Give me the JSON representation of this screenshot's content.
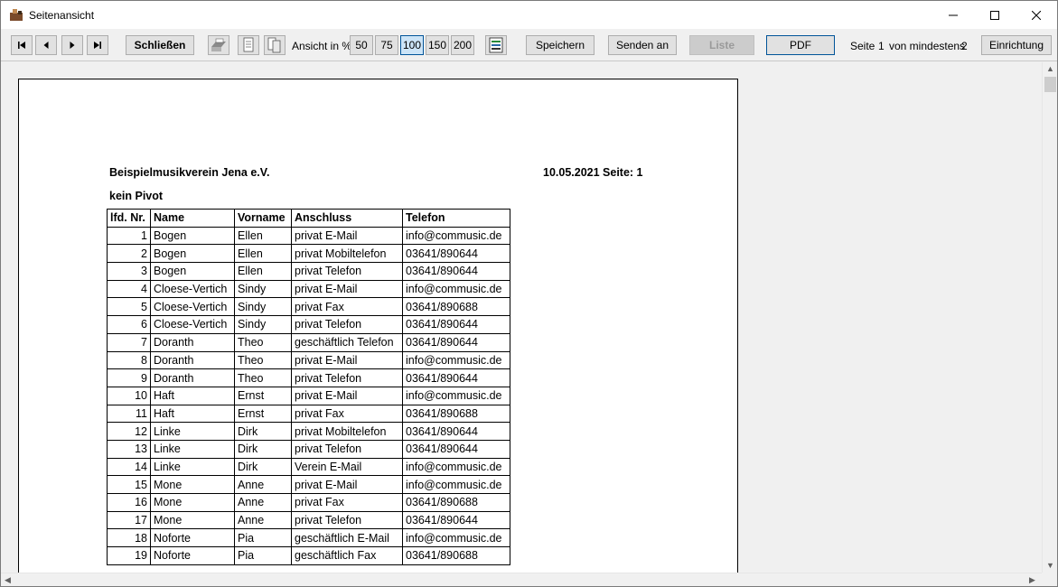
{
  "window": {
    "title": "Seitenansicht"
  },
  "toolbar": {
    "close_label": "Schließen",
    "zoom_label": "Ansicht in %",
    "zoom_options": [
      "50",
      "75",
      "100",
      "150",
      "200"
    ],
    "zoom_selected": "100",
    "save_label": "Speichern",
    "send_label": "Senden an",
    "list_label": "Liste",
    "pdf_label": "PDF",
    "page_info": {
      "seite": "Seite",
      "current": "1",
      "von": "von mindestens",
      "total": "2"
    },
    "setup_label": "Einrichtung"
  },
  "report": {
    "org": "Beispielmusikverein Jena e.V.",
    "date_page": "10.05.2021 Seite: 1",
    "subtitle": "kein Pivot",
    "columns": [
      "lfd. Nr.",
      "Name",
      "Vorname",
      "Anschluss",
      "Telefon"
    ],
    "rows": [
      [
        "1",
        "Bogen",
        "Ellen",
        "privat E-Mail",
        "info@commusic.de"
      ],
      [
        "2",
        "Bogen",
        "Ellen",
        "privat Mobiltelefon",
        "03641/890644"
      ],
      [
        "3",
        "Bogen",
        "Ellen",
        "privat Telefon",
        "03641/890644"
      ],
      [
        "4",
        "Cloese-Vertich",
        "Sindy",
        "privat E-Mail",
        "info@commusic.de"
      ],
      [
        "5",
        "Cloese-Vertich",
        "Sindy",
        "privat Fax",
        "03641/890688"
      ],
      [
        "6",
        "Cloese-Vertich",
        "Sindy",
        "privat Telefon",
        "03641/890644"
      ],
      [
        "7",
        "Doranth",
        "Theo",
        "geschäftlich Telefon",
        "03641/890644"
      ],
      [
        "8",
        "Doranth",
        "Theo",
        "privat E-Mail",
        "info@commusic.de"
      ],
      [
        "9",
        "Doranth",
        "Theo",
        "privat Telefon",
        "03641/890644"
      ],
      [
        "10",
        "Haft",
        "Ernst",
        "privat E-Mail",
        "info@commusic.de"
      ],
      [
        "11",
        "Haft",
        "Ernst",
        "privat Fax",
        "03641/890688"
      ],
      [
        "12",
        "Linke",
        "Dirk",
        "privat Mobiltelefon",
        "03641/890644"
      ],
      [
        "13",
        "Linke",
        "Dirk",
        "privat Telefon",
        "03641/890644"
      ],
      [
        "14",
        "Linke",
        "Dirk",
        "Verein E-Mail",
        "info@commusic.de"
      ],
      [
        "15",
        "Mone",
        "Anne",
        "privat E-Mail",
        "info@commusic.de"
      ],
      [
        "16",
        "Mone",
        "Anne",
        "privat Fax",
        "03641/890688"
      ],
      [
        "17",
        "Mone",
        "Anne",
        "privat Telefon",
        "03641/890644"
      ],
      [
        "18",
        "Noforte",
        "Pia",
        "geschäftlich E-Mail",
        "info@commusic.de"
      ],
      [
        "19",
        "Noforte",
        "Pia",
        "geschäftlich Fax",
        "03641/890688"
      ]
    ]
  },
  "icons": {
    "first": "first-page-icon",
    "prev": "previous-page-icon",
    "next": "next-page-icon",
    "last": "last-page-icon"
  }
}
